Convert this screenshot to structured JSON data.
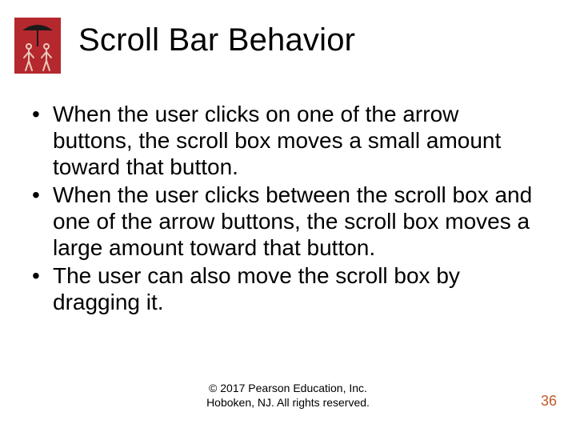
{
  "title": "Scroll Bar Behavior",
  "bullets": [
    "When the user clicks on one of the arrow buttons, the scroll box moves a small amount toward that button.",
    "When the user clicks between the scroll box and one of the arrow buttons, the scroll box moves a large amount toward that button.",
    "The user can also move the scroll box by dragging it."
  ],
  "copyright_line1": "© 2017 Pearson Education, Inc.",
  "copyright_line2": "Hoboken, NJ. All rights reserved.",
  "page_number": "36",
  "logo": {
    "bg": "#b4282e",
    "accent": "#e9c9b9"
  }
}
